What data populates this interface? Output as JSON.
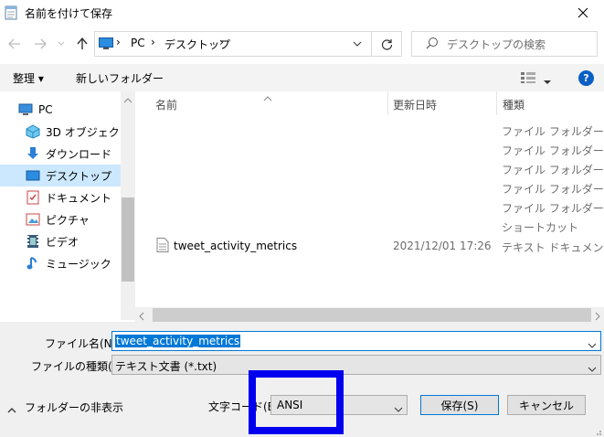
{
  "window": {
    "title": "名前を付けて保存"
  },
  "address": {
    "path": [
      "PC",
      "デスクトップ"
    ]
  },
  "search": {
    "placeholder": "デスクトップの検索"
  },
  "toolbar": {
    "organize_label": "整理 ▾",
    "new_folder_label": "新しいフォルダー",
    "help_label": "?"
  },
  "nav": {
    "items": [
      {
        "label": "PC",
        "icon": "pc-icon"
      },
      {
        "label": "3D オブジェクト",
        "icon": "3d-objects-icon"
      },
      {
        "label": "ダウンロード",
        "icon": "download-icon"
      },
      {
        "label": "デスクトップ",
        "icon": "desktop-icon",
        "selected": true
      },
      {
        "label": "ドキュメント",
        "icon": "documents-icon"
      },
      {
        "label": "ピクチャ",
        "icon": "pictures-icon"
      },
      {
        "label": "ビデオ",
        "icon": "videos-icon"
      },
      {
        "label": "ミュージック",
        "icon": "music-icon"
      }
    ]
  },
  "files": {
    "columns": {
      "name": "名前",
      "date": "更新日時",
      "type": "種類"
    },
    "rows": [
      {
        "name": "",
        "date": "",
        "type": "ファイル フォルダー"
      },
      {
        "name": "",
        "date": "",
        "type": "ファイル フォルダー"
      },
      {
        "name": "",
        "date": "",
        "type": "ファイル フォルダー"
      },
      {
        "name": "",
        "date": "",
        "type": "ファイル フォルダー"
      },
      {
        "name": "",
        "date": "",
        "type": "ファイル フォルダー"
      },
      {
        "name": "",
        "date": "",
        "type": "ショートカット"
      },
      {
        "name": "tweet_activity_metrics",
        "date": "2021/12/01 17:26",
        "type": "テキスト ドキュメント"
      }
    ]
  },
  "form": {
    "filename_label": "ファイル名(N):",
    "filename_value": "tweet_activity_metrics",
    "filetype_label": "ファイルの種類(T):",
    "filetype_value": "テキスト文書 (*.txt)",
    "encoding_label": "文字コード(E):",
    "encoding_value": "ANSI",
    "hide_folders_label": "フォルダーの非表示",
    "save_label": "保存(S)",
    "cancel_label": "キャンセル"
  },
  "colors": {
    "accent": "#0078d7",
    "highlight_box": "#0000ee",
    "selected_nav": "#cce8ff"
  }
}
